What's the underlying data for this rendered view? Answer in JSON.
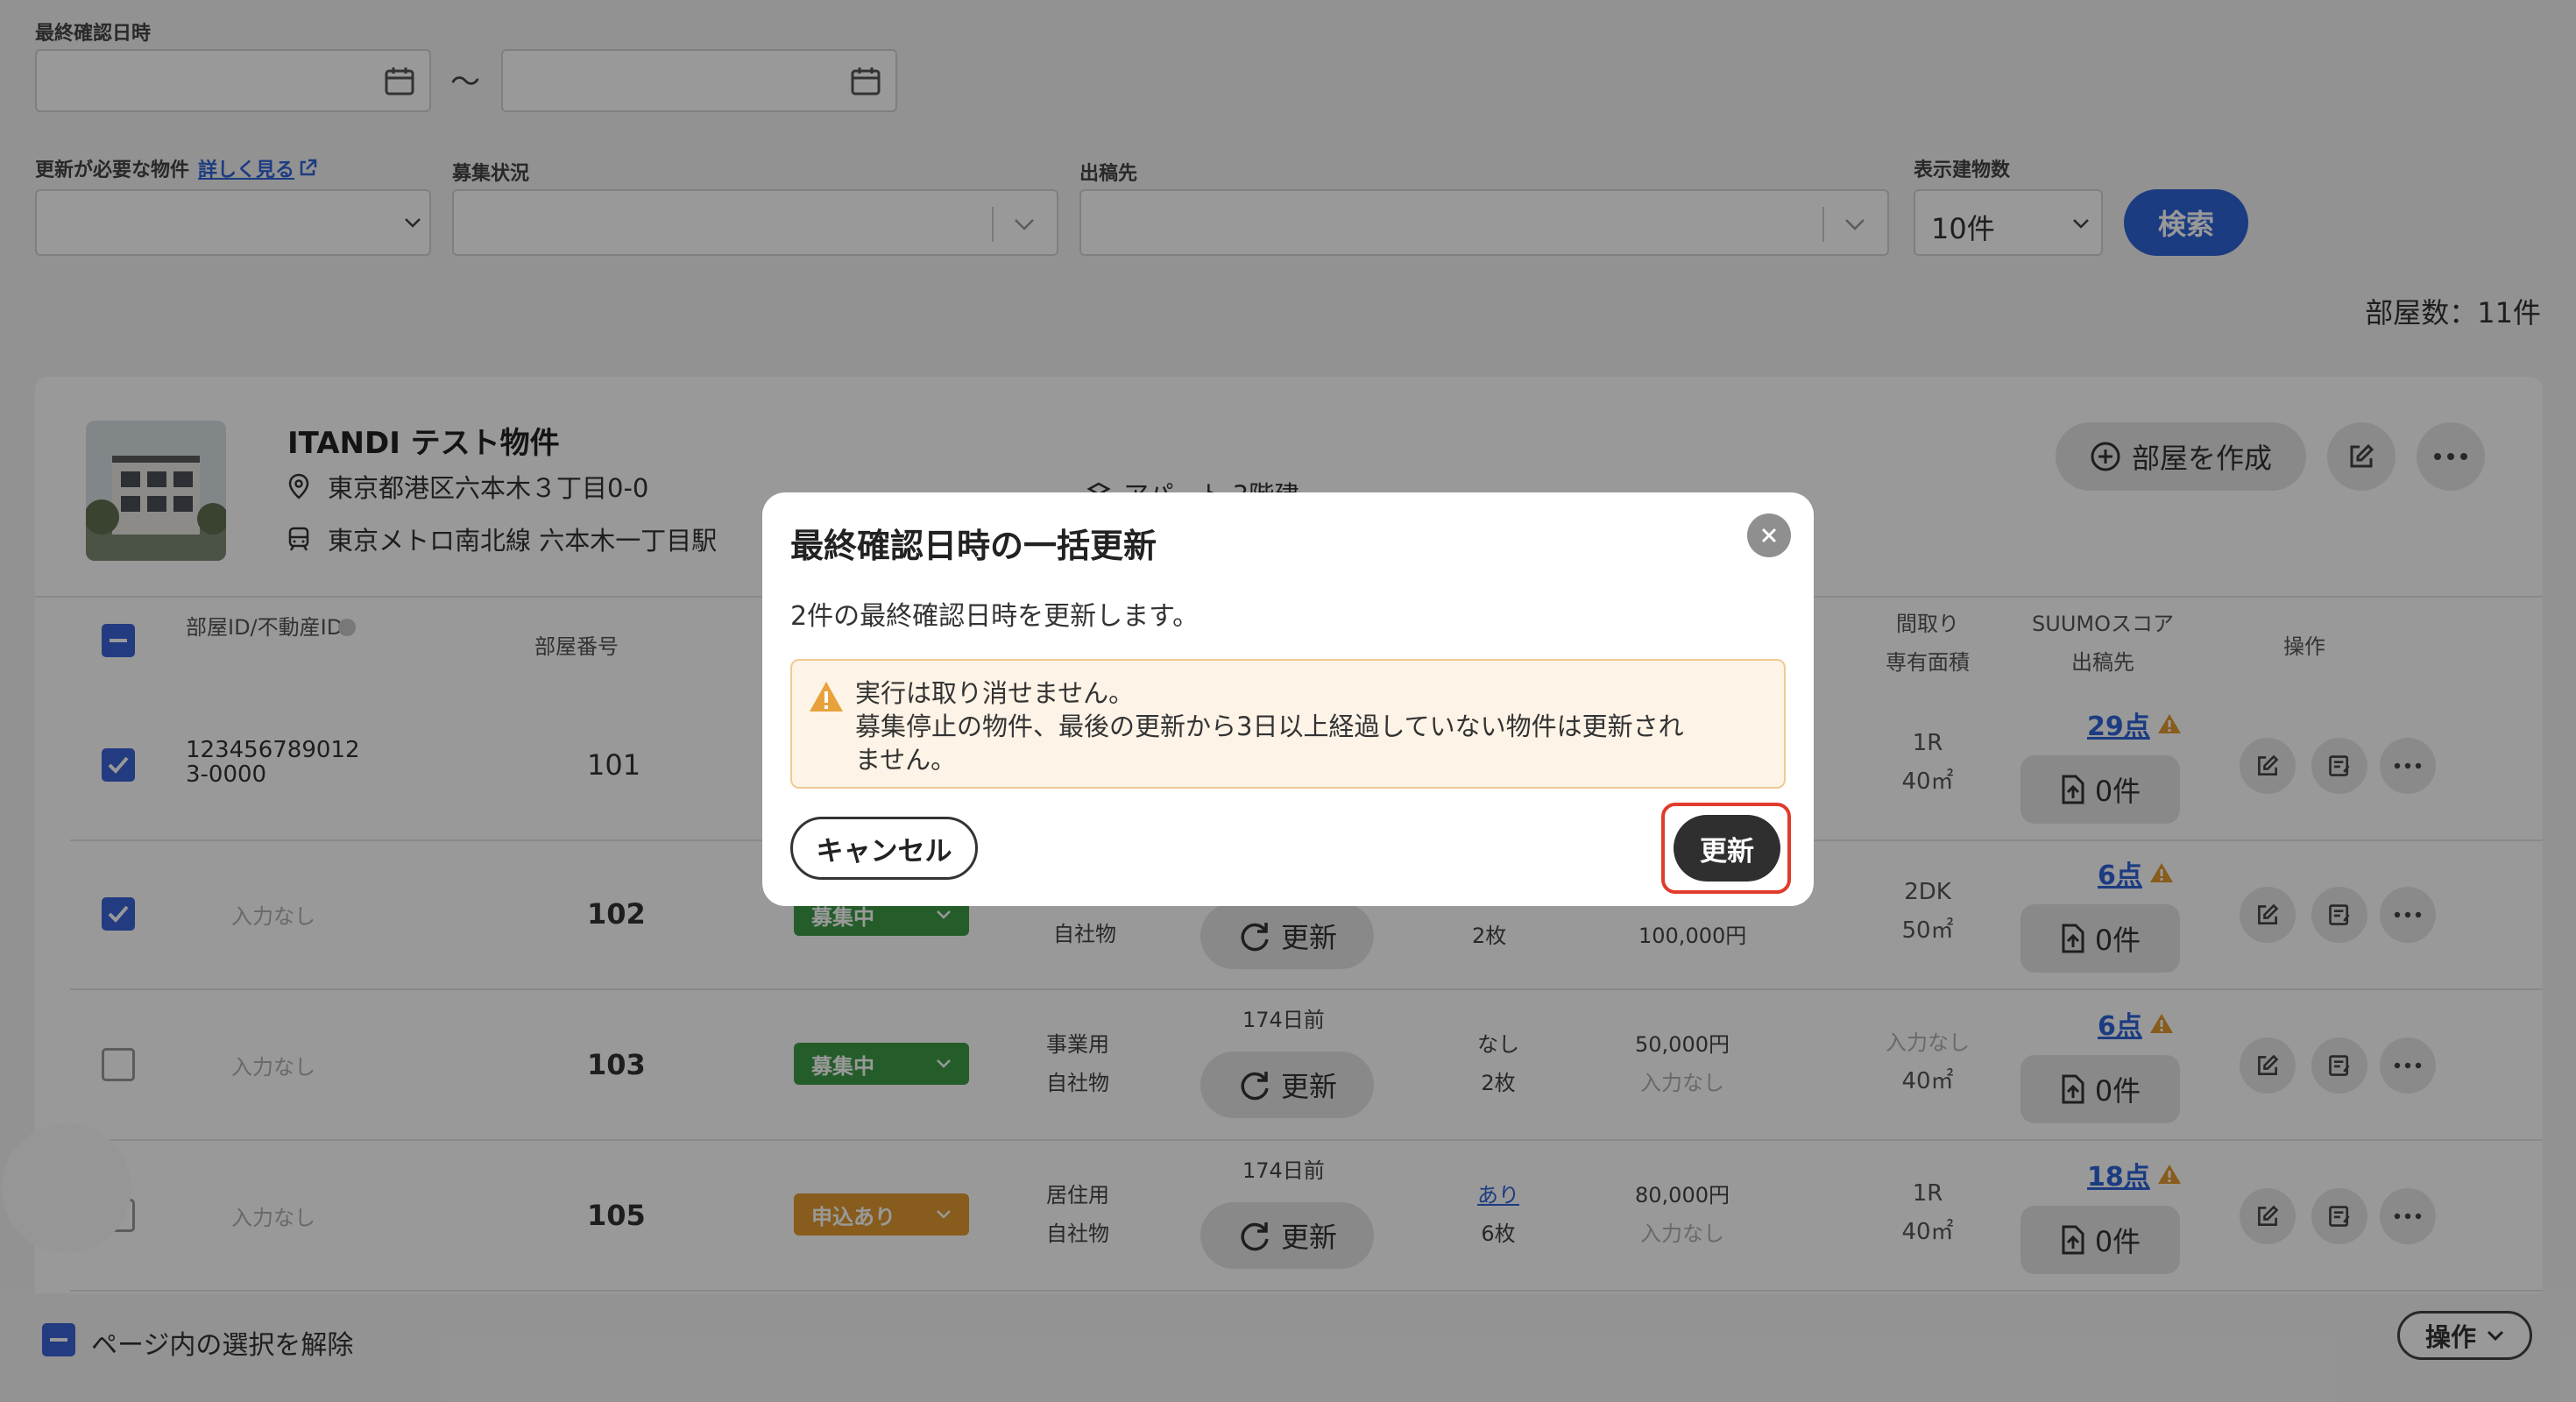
{
  "filters": {
    "last_confirmed_label": "最終確認日時",
    "range_sep": "〜",
    "needs_update_label": "更新が必要な物件",
    "details_link": "詳しく見る",
    "recruit_status_label": "募集状況",
    "publish_dest_label": "出稿先",
    "display_count_label": "表示建物数",
    "display_count_value": "10件",
    "search_button": "検索",
    "room_count": "部屋数：11件"
  },
  "property": {
    "name": "ITANDI テスト物件",
    "address": "東京都港区六本木３丁目0-0",
    "station": "東京メトロ南北線 六本木一丁目駅",
    "building_type": "アパート 3階建",
    "create_room_button": "部屋を作成"
  },
  "table": {
    "headers": {
      "room_id": "部屋ID/不動産ID",
      "room_number": "部屋番号",
      "layout": "間取り",
      "area": "専有面積",
      "suumo_score": "SUUMOスコア",
      "publish_dest": "出稿先",
      "actions": "操作"
    },
    "rows": [
      {
        "id": "123456789012\n3-0000",
        "number": "101",
        "status": "",
        "usage": "",
        "owner": "",
        "days_ago": "",
        "update": "",
        "ad": "",
        "ad_count": "",
        "rent": "",
        "fee": "",
        "layout": "1R",
        "area": "40㎡",
        "score": "29点",
        "publish": "0件"
      },
      {
        "id": "入力なし",
        "number": "102",
        "status": "募集中",
        "usage": "",
        "owner": "自社物",
        "days_ago": "",
        "update": "更新",
        "ad": "",
        "ad_count": "2枚",
        "rent": "100,000円",
        "fee": "",
        "layout": "2DK",
        "area": "50㎡",
        "score": "6点",
        "publish": "0件"
      },
      {
        "id": "入力なし",
        "number": "103",
        "status": "募集中",
        "usage": "事業用",
        "owner": "自社物",
        "days_ago": "174日前",
        "update": "更新",
        "ad": "なし",
        "ad_count": "2枚",
        "rent": "50,000円",
        "fee": "入力なし",
        "layout": "入力なし",
        "area": "40㎡",
        "score": "6点",
        "publish": "0件"
      },
      {
        "id": "入力なし",
        "number": "105",
        "status": "申込あり",
        "usage": "居住用",
        "owner": "自社物",
        "days_ago": "174日前",
        "update": "更新",
        "ad": "あり",
        "ad_count": "6枚",
        "rent": "80,000円",
        "fee": "入力なし",
        "layout": "1R",
        "area": "40㎡",
        "score": "18点",
        "publish": "0件"
      }
    ]
  },
  "footer": {
    "deselect_label": "ページ内の選択を解除",
    "actions_button": "操作"
  },
  "modal": {
    "title": "最終確認日時の一括更新",
    "description": "2件の最終確認日時を更新します。",
    "warning_line1": "実行は取り消せません。",
    "warning_line2": "募集停止の物件、最後の更新から3日以上経過していない物件は更新され",
    "warning_line3": "ません。",
    "cancel_button": "キャンセル",
    "confirm_button": "更新"
  },
  "colors": {
    "primary": "#2f64d8",
    "checkbox": "#3b63d6",
    "status_recruiting": "#3f9c46",
    "status_applied": "#e19a2f",
    "highlight": "#e03b2c",
    "warning_bg": "#fdf3e6"
  }
}
